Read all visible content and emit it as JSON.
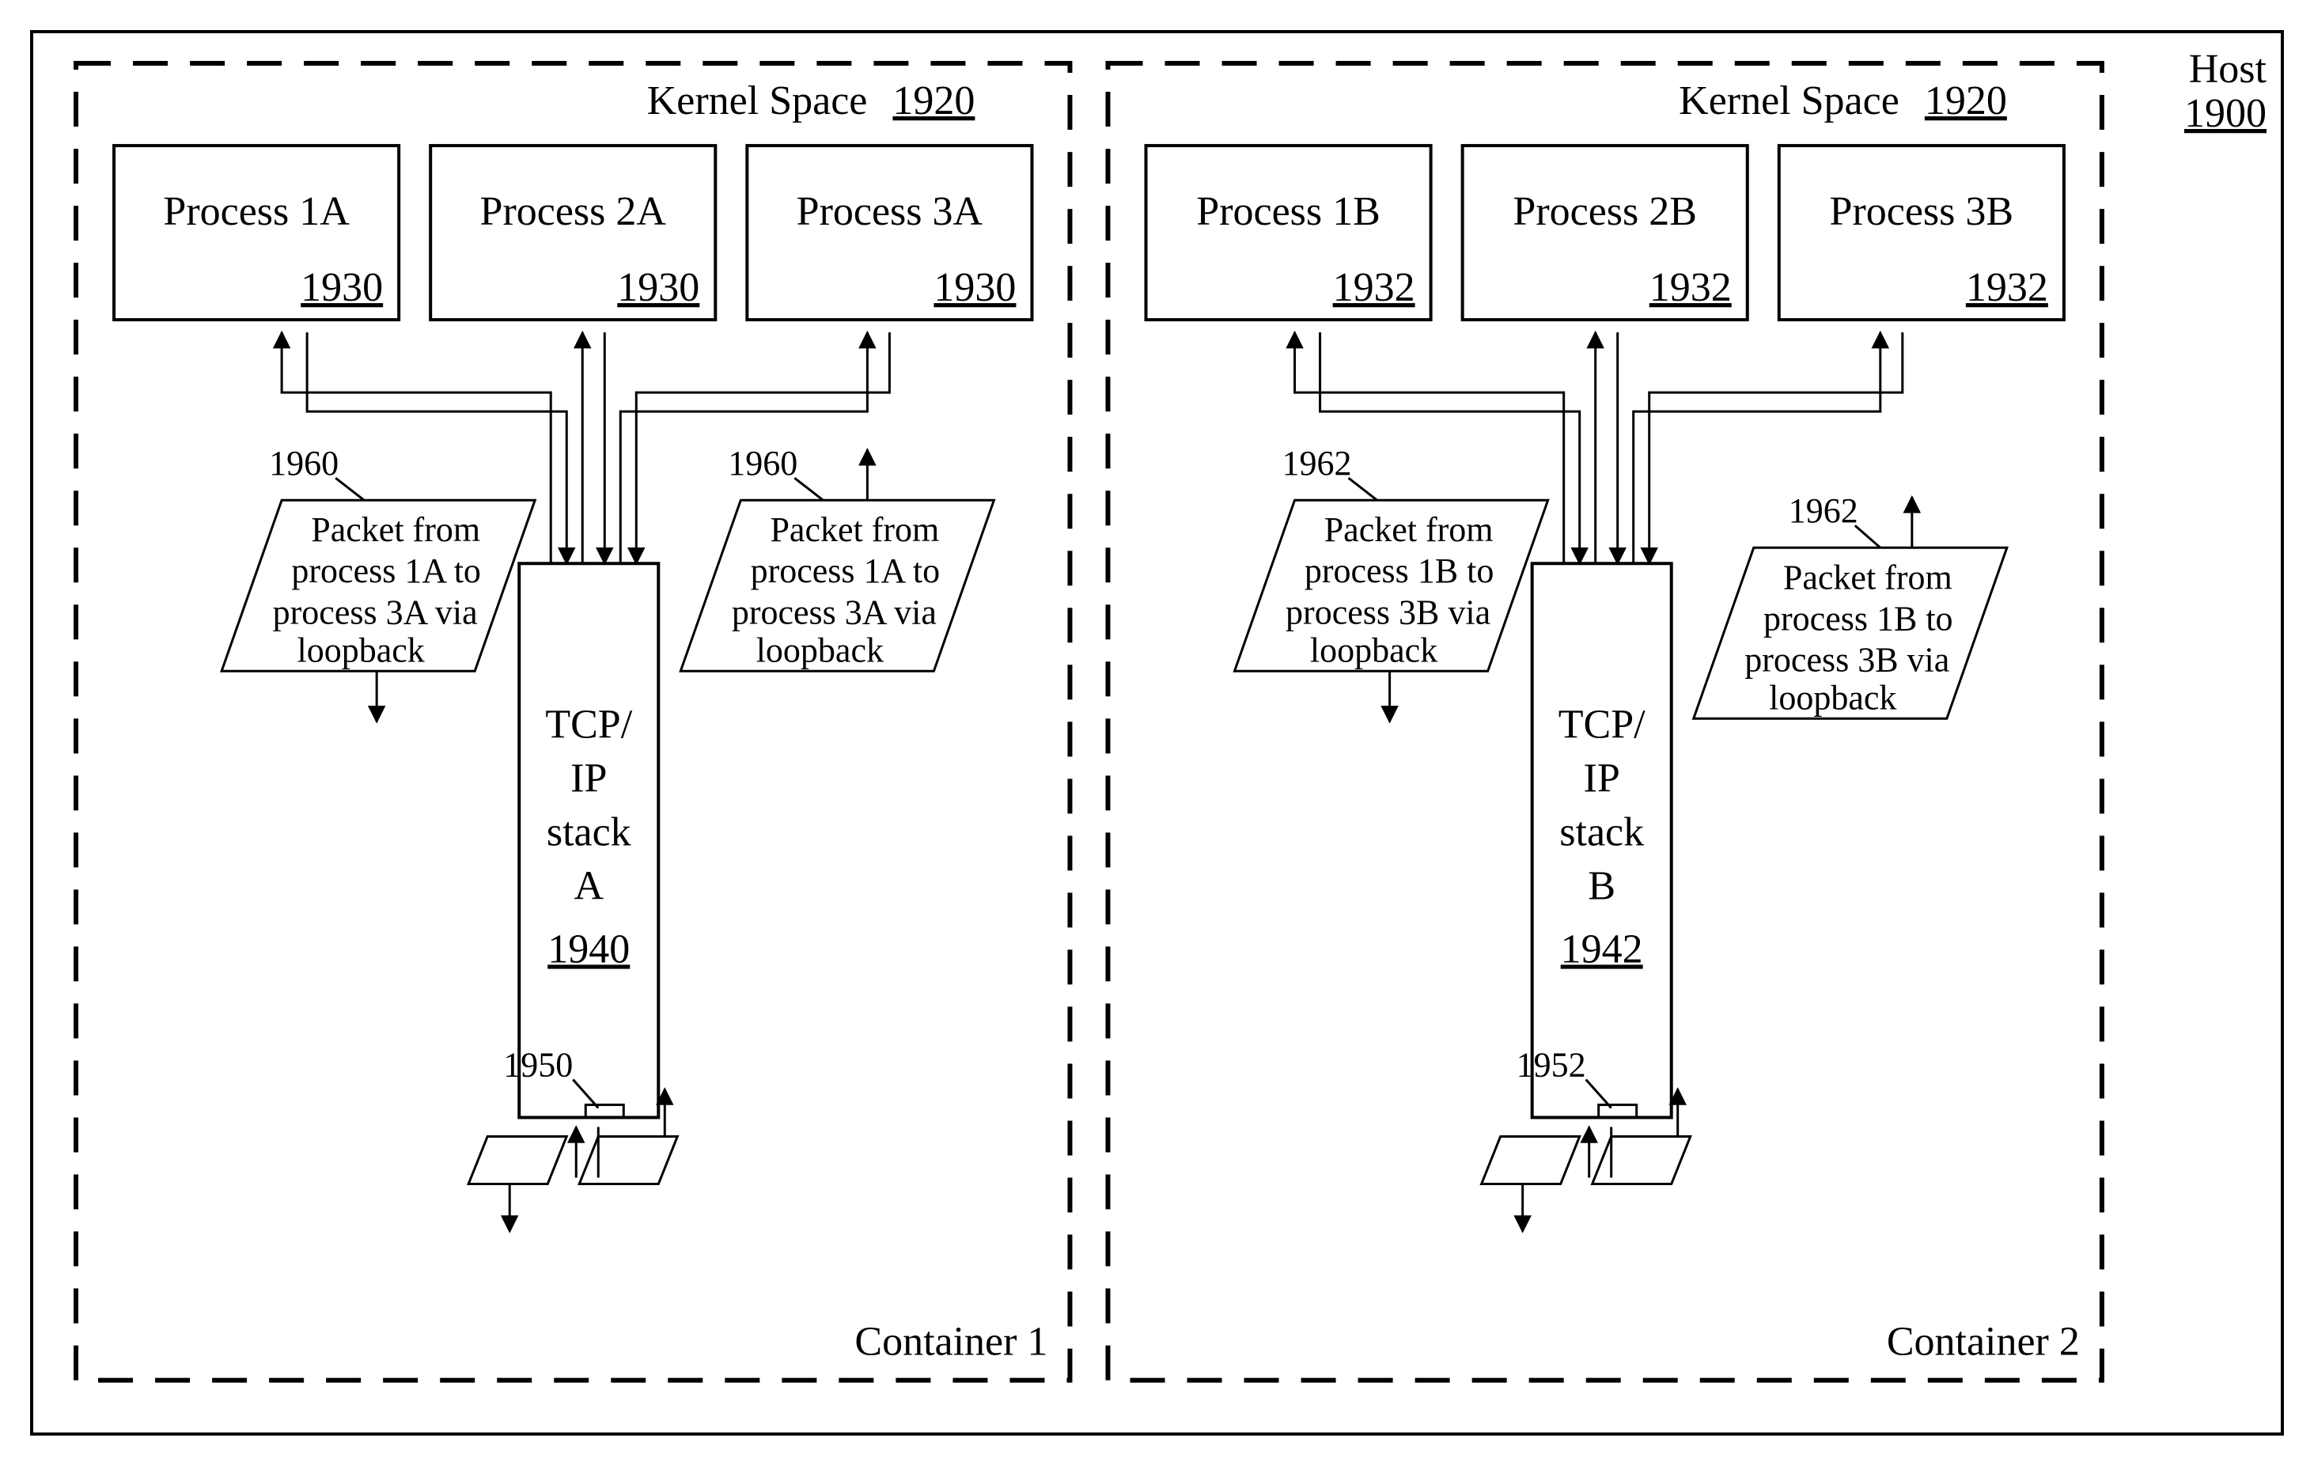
{
  "host": {
    "label": "Host",
    "ref": "1900"
  },
  "containers": [
    {
      "name": "Container 1",
      "kernel": {
        "label": "Kernel Space",
        "ref": "1920"
      },
      "processes": [
        {
          "title": "Process 1A",
          "ref": "1930"
        },
        {
          "title": "Process 2A",
          "ref": "1930"
        },
        {
          "title": "Process 3A",
          "ref": "1930"
        }
      ],
      "stack": {
        "line1": "TCP/",
        "line2": "IP",
        "line3": "stack",
        "line4": "A",
        "ref": "1940"
      },
      "iface_ref": "1950",
      "packets": {
        "ref": "1960",
        "l1": "Packet from",
        "l2": "process 1A to",
        "l3": "process 3A via",
        "l4": "loopback"
      }
    },
    {
      "name": "Container 2",
      "kernel": {
        "label": "Kernel Space",
        "ref": "1920"
      },
      "processes": [
        {
          "title": "Process 1B",
          "ref": "1932"
        },
        {
          "title": "Process 2B",
          "ref": "1932"
        },
        {
          "title": "Process 3B",
          "ref": "1932"
        }
      ],
      "stack": {
        "line1": "TCP/",
        "line2": "IP",
        "line3": "stack",
        "line4": "B",
        "ref": "1942"
      },
      "iface_ref": "1952",
      "packets": {
        "ref": "1962",
        "l1": "Packet from",
        "l2": "process 1B to",
        "l3": "process 3B via",
        "l4": "loopback"
      }
    }
  ]
}
